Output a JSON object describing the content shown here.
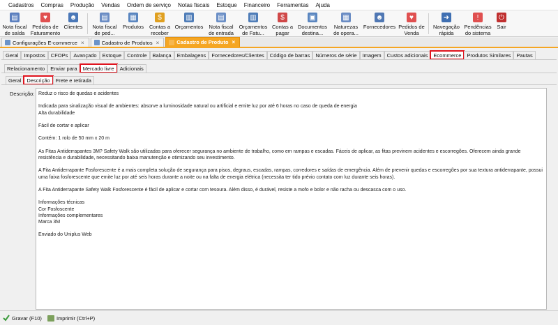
{
  "menu": [
    "Cadastros",
    "Compras",
    "Produção",
    "Vendas",
    "Ordem de serviço",
    "Notas fiscais",
    "Estoque",
    "Financeiro",
    "Ferramentas",
    "Ajuda"
  ],
  "toolbar": [
    {
      "label": "Nota fiscal\nde saída",
      "icon": "invoice-icon",
      "color": "#5b7fbf"
    },
    {
      "label": "Pedidos de\nFaturamento",
      "icon": "orders-icon",
      "color": "#e05050"
    },
    {
      "label": "Clientes",
      "icon": "clients-icon",
      "color": "#4a78b8"
    },
    {
      "label": "Nota fiscal\nde ped...",
      "icon": "order-invoice-icon",
      "color": "#6a8cc4"
    },
    {
      "label": "Produtos",
      "icon": "products-icon",
      "color": "#5a86c0"
    },
    {
      "label": "Contas a\nreceber",
      "icon": "receivables-icon",
      "color": "#e0a020"
    },
    {
      "label": "Orçamentos",
      "icon": "quotes-icon",
      "color": "#4f7db8"
    },
    {
      "label": "Nota fiscal\nde entrada",
      "icon": "inbound-invoice-icon",
      "color": "#6b8fc6"
    },
    {
      "label": "Orçamentos\nde Fatu...",
      "icon": "billing-quotes-icon",
      "color": "#4f7db8"
    },
    {
      "label": "Contas a\npagar",
      "icon": "payables-icon",
      "color": "#d04848"
    },
    {
      "label": "Documentos\ndestina...",
      "icon": "documents-icon",
      "color": "#5a86c0"
    },
    {
      "label": "Naturezas\nde opera...",
      "icon": "operations-icon",
      "color": "#6a8cc4"
    },
    {
      "label": "Fornecedores",
      "icon": "suppliers-icon",
      "color": "#5078b4"
    },
    {
      "label": "Pedidos de\nVenda",
      "icon": "sales-orders-icon",
      "color": "#e05050"
    },
    {
      "label": "Navegação\nrápida",
      "icon": "quick-nav-icon",
      "color": "#3f6fb2"
    },
    {
      "label": "Pendências\ndo sistema",
      "icon": "pending-icon",
      "color": "#e05050"
    },
    {
      "label": "Sair",
      "icon": "exit-icon",
      "color": "#c03030"
    }
  ],
  "doc_tabs": [
    {
      "label": "Configurações E-commerce",
      "active": false
    },
    {
      "label": "Cadastro de Produtos",
      "active": false
    },
    {
      "label": "Cadastro de Produto",
      "active": true
    }
  ],
  "tabs_main": [
    "Geral",
    "Impostos",
    "CFOPs",
    "Avançado",
    "Estoque",
    "Controle",
    "Balança",
    "Embalagens",
    "Fornecedores/Clientes",
    "Código de barras",
    "Números de série",
    "Imagem",
    "Custos adicionais",
    "Ecommerce",
    "Produtos Similares",
    "Pautas"
  ],
  "tabs_ecommerce": [
    "Relacionamento",
    "Enviar para",
    "Mercado livre",
    "Adicionais"
  ],
  "tabs_ml": [
    "Geral",
    "Descrição",
    "Frete e retirada"
  ],
  "description": {
    "label": "Descrição:",
    "paragraphs": [
      "Reduz o risco de quedas e acidentes",
      "Indicada para sinalização visual de ambientes: absorve a luminosidade natural ou artificial e emite luz por até 6 horas no caso de queda de energia\nAlta durabilidade",
      "Fácil de cortar e aplicar",
      "Contém: 1 rolo de 50 mm x 20 m",
      "As Fitas Antiderrapantes 3M? Safety Walk são utilizadas para oferecer segurança no ambiente de trabalho, como em rampas e escadas. Fáceis de aplicar, as fitas previnem acidentes e escorregões. Oferecem ainda grande resistência e durabilidade, necessitando baixa manutenção e otimizando seu investimento.",
      "A Fita Antiderrapante Fosforescente é a mais completa solução de segurança para pisos, degraus, escadas, rampas, corredores e saídas de emergência. Além de prevenir quedas e escorregões por sua textura antiderrapante, possui uma faixa fosforescente que emite luz por até seis horas durante a noite ou na falta de energia elétrica (necessita ter tido prévio contato com luz durante seis horas).",
      "A Fita Antiderrapante Safety Walk Fosforescente é fácil de aplicar e cortar com tesoura. Além disso, é durável, resiste a mofo e bolor e não racha ou descasca com o uso.",
      "Informações técnicas\nCor Fosfoscente\nInformações complementares\nMarca 3M",
      "Enviado do Uniplus Web"
    ]
  },
  "status": {
    "save_label": "Gravar (F10)",
    "print_label": "Imprimir (Ctrl+P)"
  }
}
